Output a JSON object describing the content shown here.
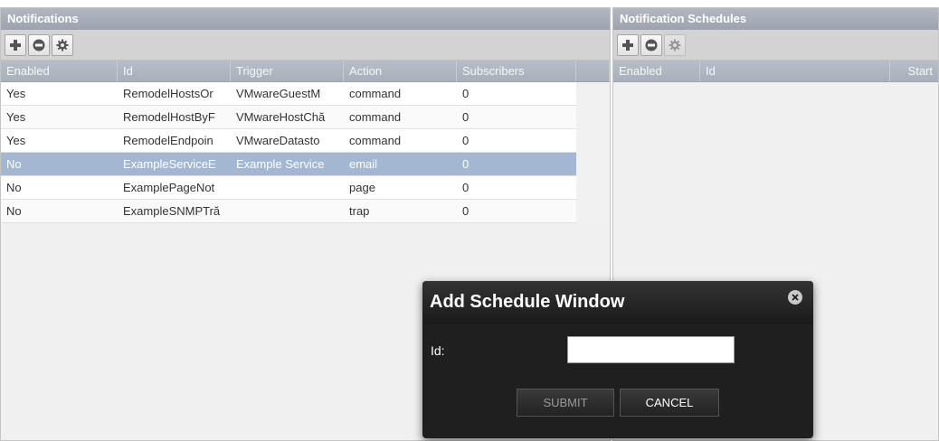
{
  "notifications": {
    "title": "Notifications",
    "toolbar": [
      "add-icon",
      "remove-icon",
      "gear-icon"
    ],
    "columns": [
      "Enabled",
      "Id",
      "Trigger",
      "Action",
      "Subscribers"
    ],
    "rows": [
      {
        "enabled": "Yes",
        "id": "RemodelHostsOr",
        "trigger": "VMwareGuestM",
        "action": "command",
        "subscribers": "0"
      },
      {
        "enabled": "Yes",
        "id": "RemodelHostByF",
        "trigger": "VMwareHostChă",
        "action": "command",
        "subscribers": "0"
      },
      {
        "enabled": "Yes",
        "id": "RemodelEndpoin",
        "trigger": "VMwareDatasto",
        "action": "command",
        "subscribers": "0"
      },
      {
        "enabled": "No",
        "id": "ExampleServiceE",
        "trigger": "Example Service",
        "action": "email",
        "subscribers": "0"
      },
      {
        "enabled": "No",
        "id": "ExamplePageNot",
        "trigger": "",
        "action": "page",
        "subscribers": "0"
      },
      {
        "enabled": "No",
        "id": "ExampleSNMPTră",
        "trigger": "",
        "action": "trap",
        "subscribers": "0"
      }
    ],
    "selected_row": 3
  },
  "schedules": {
    "title": "Notification Schedules",
    "toolbar": [
      "add-icon",
      "remove-icon",
      "gear-icon"
    ],
    "columns": [
      "Enabled",
      "Id",
      "Start"
    ]
  },
  "modal": {
    "title": "Add Schedule Window",
    "id_label": "Id:",
    "id_value": "",
    "submit_label": "SUBMIT",
    "cancel_label": "CANCEL"
  },
  "colors": {
    "header": "#9ca3ae",
    "selected_row": "#a3b7d3",
    "modal_bg": "#1f1f1f"
  }
}
